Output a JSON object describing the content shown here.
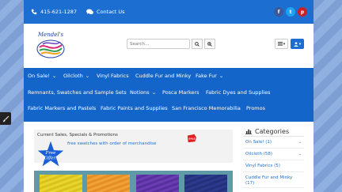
{
  "topbar": {
    "phone": "415-621-1287",
    "contact": "Contact Us",
    "socials": [
      {
        "icon": "facebook-icon",
        "glyph": "f",
        "color": "#3b5998"
      },
      {
        "icon": "twitter-icon",
        "glyph": "t",
        "color": "#1da1f2"
      },
      {
        "icon": "pinterest-icon",
        "glyph": "p",
        "color": "#cb2027"
      }
    ]
  },
  "header": {
    "logo_text": "Mendel's",
    "search_placeholder": "Search..."
  },
  "nav": {
    "items": [
      {
        "label": "On Sale!",
        "caret": "⌄"
      },
      {
        "label": "Oilcloth",
        "caret": "⌄"
      },
      {
        "label": "Vinyl Fabrics",
        "caret": ""
      },
      {
        "label": "Cuddle Fur and Minky",
        "caret": ""
      },
      {
        "label": "Fake Fur",
        "caret": "⌄"
      },
      {
        "label": "Remnants, Swatches and Sample Sets",
        "caret": ""
      },
      {
        "label": "Notions",
        "caret": "⌄"
      },
      {
        "label": "Posca Markers",
        "caret": ""
      },
      {
        "label": "Fabric Dyes and Supplies",
        "caret": ""
      },
      {
        "label": "Fabric Markers and Pastels",
        "caret": ""
      },
      {
        "label": "Fabric Paints and Supplies",
        "caret": ""
      },
      {
        "label": "San Francisco Memorabilia",
        "caret": ""
      },
      {
        "label": "Promos",
        "caret": ""
      }
    ]
  },
  "main": {
    "banner_title": "Current Sales, Specials & Promotions",
    "star_text_1": "Free",
    "star_text_2": "Offer!",
    "banner_text": "free swatches with order of merchandise",
    "sale_tag": "SALE"
  },
  "sidebar": {
    "title": "Categories",
    "items": [
      {
        "label": "On Sale! (1)",
        "chevron": "⌄"
      },
      {
        "label": "Oilcloth (58)",
        "chevron": "⌄"
      },
      {
        "label": "Vinyl Fabrics (5)",
        "chevron": ""
      },
      {
        "label": "Cuddle Fur and Minky (17)",
        "chevron": ""
      }
    ]
  },
  "colors": {
    "topbar": "#1c6fd1",
    "navbar": "#1465c9",
    "star": "#1b5fd6",
    "gallery": "#5f9aa6"
  }
}
